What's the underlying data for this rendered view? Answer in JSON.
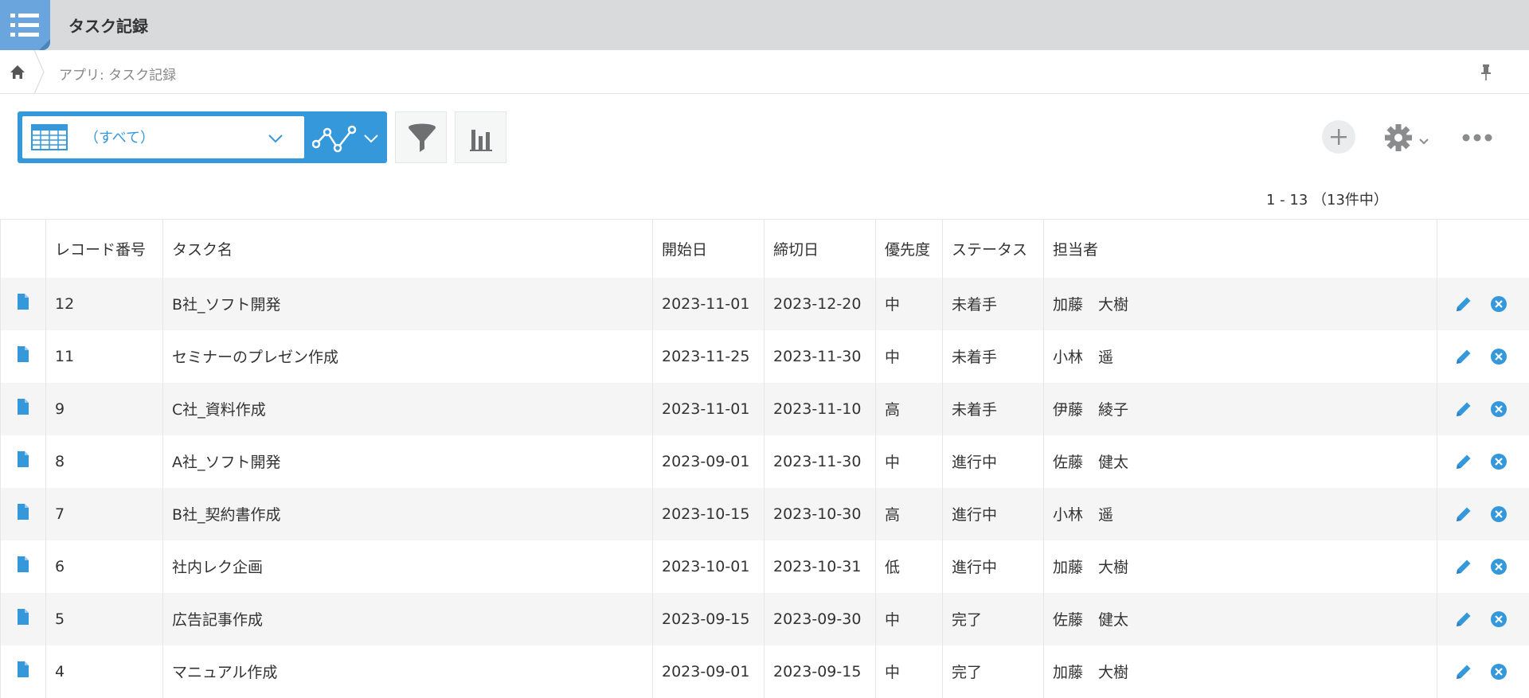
{
  "app": {
    "title": "タスク記録"
  },
  "breadcrumb": {
    "text": "アプリ: タスク記録"
  },
  "toolbar": {
    "view_label": "（すべて）"
  },
  "pagination": {
    "text": "1 - 13 （13件中）"
  },
  "columns": [
    "レコード番号",
    "タスク名",
    "開始日",
    "締切日",
    "優先度",
    "ステータス",
    "担当者"
  ],
  "records": [
    {
      "id": "12",
      "name": "B社_ソフト開発",
      "start": "2023-11-01",
      "due": "2023-12-20",
      "priority": "中",
      "status": "未着手",
      "assignee": "加藤　大樹"
    },
    {
      "id": "11",
      "name": "セミナーのプレゼン作成",
      "start": "2023-11-25",
      "due": "2023-11-30",
      "priority": "中",
      "status": "未着手",
      "assignee": "小林　遥"
    },
    {
      "id": "9",
      "name": "C社_資料作成",
      "start": "2023-11-01",
      "due": "2023-11-10",
      "priority": "高",
      "status": "未着手",
      "assignee": "伊藤　綾子"
    },
    {
      "id": "8",
      "name": "A社_ソフト開発",
      "start": "2023-09-01",
      "due": "2023-11-30",
      "priority": "中",
      "status": "進行中",
      "assignee": "佐藤　健太"
    },
    {
      "id": "7",
      "name": "B社_契約書作成",
      "start": "2023-10-15",
      "due": "2023-10-30",
      "priority": "高",
      "status": "進行中",
      "assignee": "小林　遥"
    },
    {
      "id": "6",
      "name": "社内レク企画",
      "start": "2023-10-01",
      "due": "2023-10-31",
      "priority": "低",
      "status": "進行中",
      "assignee": "加藤　大樹"
    },
    {
      "id": "5",
      "name": "広告記事作成",
      "start": "2023-09-15",
      "due": "2023-09-30",
      "priority": "中",
      "status": "完了",
      "assignee": "佐藤　健太"
    },
    {
      "id": "4",
      "name": "マニュアル作成",
      "start": "2023-09-01",
      "due": "2023-09-15",
      "priority": "中",
      "status": "完了",
      "assignee": "加藤　大樹"
    }
  ],
  "icons": {
    "app": "list-icon",
    "home": "home-icon",
    "pin": "pin-icon",
    "view": "table-view-icon",
    "graph": "line-graph-icon",
    "filter": "filter-icon",
    "chart": "bar-chart-icon",
    "add": "plus-icon",
    "settings": "gear-icon",
    "more": "more-dots-icon",
    "record": "document-icon",
    "edit": "pencil-icon",
    "delete": "close-circle-icon"
  },
  "colors": {
    "accent": "#3498db",
    "header_bg": "#d8dadb",
    "app_icon": "#6aa6dd"
  }
}
